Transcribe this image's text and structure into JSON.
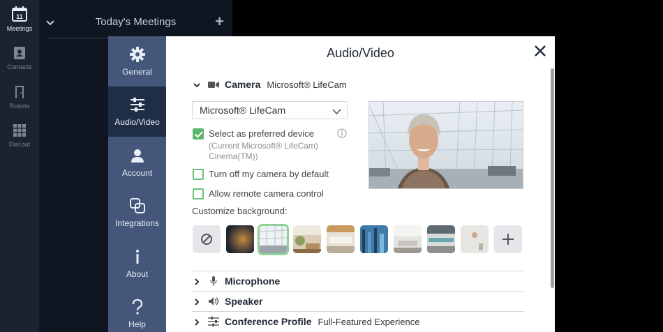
{
  "app_rail": {
    "items": [
      {
        "label": "Meetings",
        "icon": "calendar-icon",
        "badge": "11"
      },
      {
        "label": "Contacts",
        "icon": "contacts-icon"
      },
      {
        "label": "Rooms",
        "icon": "door-icon"
      },
      {
        "label": "Dial out",
        "icon": "dialpad-icon"
      }
    ]
  },
  "meetings_panel": {
    "title": "Today's Meetings",
    "add": "+"
  },
  "settings_nav": {
    "items": [
      {
        "label": "General",
        "icon": "gear-icon"
      },
      {
        "label": "Audio/Video",
        "icon": "sliders-icon",
        "active": true
      },
      {
        "label": "Account",
        "icon": "user-icon"
      },
      {
        "label": "Integrations",
        "icon": "overlap-squares-icon"
      },
      {
        "label": "About",
        "icon": "info-i-icon"
      },
      {
        "label": "Help",
        "icon": "question-icon"
      }
    ]
  },
  "dialog": {
    "title": "Audio/Video",
    "camera": {
      "label": "Camera",
      "device": "Microsoft® LifeCam",
      "select_value": "Microsoft® LifeCam",
      "preferred": {
        "label": "Select as preferred device",
        "checked": true,
        "hint_1": "(Current Microsoft® LifeCam)",
        "hint_2": "Cinema(TM))"
      },
      "turn_off": {
        "label": "Turn off my camera by default",
        "checked": false
      },
      "remote": {
        "label": "Allow remote camera control",
        "checked": false
      },
      "background_label": "Customize background:"
    },
    "sections": [
      {
        "label": "Microphone",
        "icon": "microphone-icon",
        "sub": ""
      },
      {
        "label": "Speaker",
        "icon": "speaker-icon",
        "sub": ""
      },
      {
        "label": "Conference Profile",
        "icon": "sliders-icon",
        "sub": "Full-Featured Experience"
      }
    ]
  },
  "colors": {
    "accent_green": "#5cb66b",
    "nav_bg": "#44577a",
    "nav_active": "#1f2d45"
  }
}
